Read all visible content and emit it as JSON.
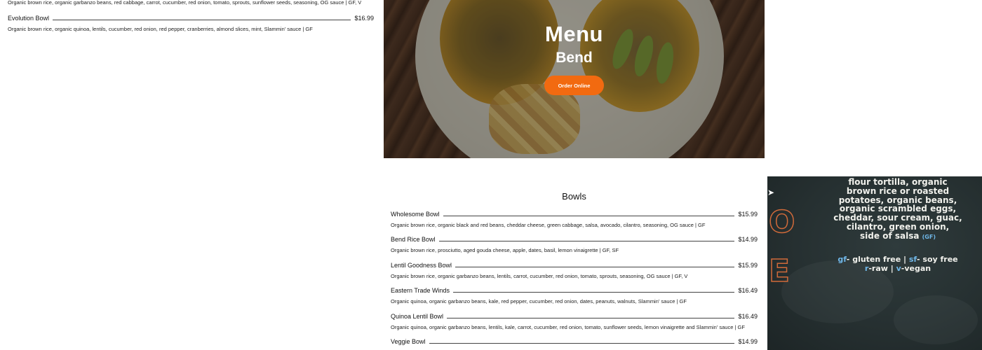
{
  "left_column": {
    "previous_item_desc": "Organic brown rice, organic garbanzo beans, red cabbage, carrot, cucumber, red onion, tomato, sprouts, sunflower seeds, seasoning, OG sauce | GF, V",
    "item": {
      "name": "Evolution Bowl",
      "price": "$16.99",
      "desc": "Organic brown rice, organic quinoa, lentils, cucumber, red onion, red pepper, cranberries, almond slices, mint, Slammin' sauce | GF"
    }
  },
  "hero": {
    "title": "Menu",
    "subtitle": "Bend",
    "order_button_label": "Order Online",
    "button_color": "#f26a10"
  },
  "bowls": {
    "title": "Bowls",
    "items": [
      {
        "name": "Wholesome Bowl",
        "price": "$15.99",
        "desc": "Organic brown rice, organic black and red beans, cheddar cheese, green cabbage, salsa, avocado, cilantro, seasoning, OG sauce | GF"
      },
      {
        "name": "Bend Rice Bowl",
        "price": "$14.99",
        "desc": "Organic brown rice, prosciutto, aged gouda cheese, apple, dates, basil, lemon vinaigrette | GF, SF"
      },
      {
        "name": "Lentil Goodness Bowl",
        "price": "$15.99",
        "desc": "Organic brown rice, organic garbanzo beans, lentils, carrot, cucumber, red onion, tomato, sprouts, seasoning, OG sauce | GF, V"
      },
      {
        "name": "Eastern Trade Winds",
        "price": "$16.49",
        "desc": "Organic quinoa, organic garbanzo beans, kale, red pepper, cucumber, red onion, dates, peanuts, walnuts, Slammin' sauce | GF"
      },
      {
        "name": "Quinoa Lentil Bowl",
        "price": "$16.49",
        "desc": "Organic quinoa, organic garbanzo beans, lentils, kale, carrot, cucumber, red onion, tomato, sunflower seeds, lemon vinaigrette and Slammin' sauce | GF"
      },
      {
        "name": "Veggie Bowl",
        "price": "$14.99",
        "desc": ""
      }
    ]
  },
  "chalkboard": {
    "lines": [
      "flour tortilla, organic",
      "brown rice or roasted",
      "potatoes, organic beans,",
      "organic scrambled eggs,",
      "cheddar, sour cream, guac,",
      "cilantro, green onion,"
    ],
    "last_line": "side of salsa",
    "last_line_tag": "(GF)",
    "legend_gf": "gf",
    "legend_gf_text": "- gluten free",
    "legend_sf": "sf",
    "legend_sf_text": "- soy free",
    "legend_r": "r",
    "legend_r_text": "-raw",
    "legend_v": "v",
    "legend_v_text": "-vegan",
    "letter_o": "O",
    "letter_e": "E",
    "text_color": "#f1f1ec",
    "accent_blue": "#6fb7e8",
    "accent_orange": "#d06a3a"
  }
}
